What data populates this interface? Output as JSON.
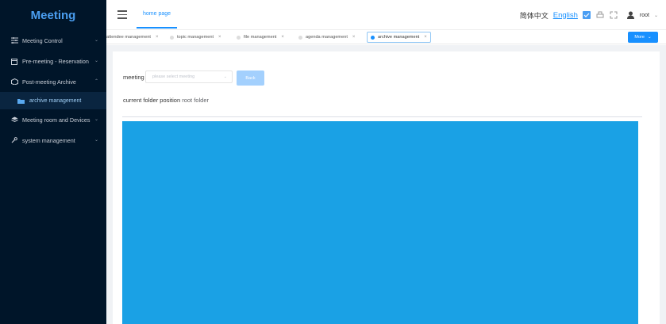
{
  "app": {
    "title": "Meeting"
  },
  "sidebar": {
    "items": [
      {
        "label": "Meeting Control",
        "icon": "sliders-icon"
      },
      {
        "label": "Pre-meeting - Reservation",
        "icon": "calendar-icon"
      },
      {
        "label": "Post-meeting Archive",
        "icon": "archive-box-icon",
        "expanded": true,
        "children": [
          {
            "label": "archive management",
            "icon": "folder-icon",
            "active": true
          }
        ]
      },
      {
        "label": "Meeting room and Devices",
        "icon": "layers-icon"
      },
      {
        "label": "system management",
        "icon": "wrench-icon"
      }
    ]
  },
  "header": {
    "home_tab": "home page",
    "lang_zh": "简体中文",
    "lang_en": "English",
    "user": "root"
  },
  "tabs": [
    {
      "label": "attendee management"
    },
    {
      "label": "topic management"
    },
    {
      "label": "file management"
    },
    {
      "label": "agenda management"
    },
    {
      "label": "archive management",
      "active": true
    }
  ],
  "more_label": "More",
  "main": {
    "meeting_label": "meeting",
    "meeting_placeholder": "please select meeting",
    "back_label": "Back",
    "folder_position_label": "current folder position",
    "folder_position_value": "root folder"
  },
  "colors": {
    "sidebar_bg": "#001529",
    "accent": "#1890ff",
    "content_panel": "#1aa1e5"
  }
}
